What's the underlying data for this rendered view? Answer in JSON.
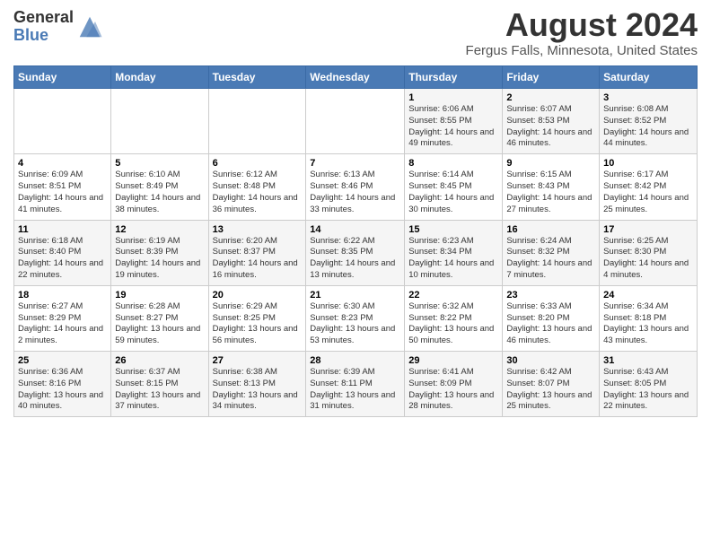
{
  "header": {
    "logo_general": "General",
    "logo_blue": "Blue",
    "month_title": "August 2024",
    "location": "Fergus Falls, Minnesota, United States"
  },
  "weekdays": [
    "Sunday",
    "Monday",
    "Tuesday",
    "Wednesday",
    "Thursday",
    "Friday",
    "Saturday"
  ],
  "weeks": [
    [
      {
        "day": "",
        "sunrise": "",
        "sunset": "",
        "daylight": ""
      },
      {
        "day": "",
        "sunrise": "",
        "sunset": "",
        "daylight": ""
      },
      {
        "day": "",
        "sunrise": "",
        "sunset": "",
        "daylight": ""
      },
      {
        "day": "",
        "sunrise": "",
        "sunset": "",
        "daylight": ""
      },
      {
        "day": "1",
        "sunrise": "Sunrise: 6:06 AM",
        "sunset": "Sunset: 8:55 PM",
        "daylight": "Daylight: 14 hours and 49 minutes."
      },
      {
        "day": "2",
        "sunrise": "Sunrise: 6:07 AM",
        "sunset": "Sunset: 8:53 PM",
        "daylight": "Daylight: 14 hours and 46 minutes."
      },
      {
        "day": "3",
        "sunrise": "Sunrise: 6:08 AM",
        "sunset": "Sunset: 8:52 PM",
        "daylight": "Daylight: 14 hours and 44 minutes."
      }
    ],
    [
      {
        "day": "4",
        "sunrise": "Sunrise: 6:09 AM",
        "sunset": "Sunset: 8:51 PM",
        "daylight": "Daylight: 14 hours and 41 minutes."
      },
      {
        "day": "5",
        "sunrise": "Sunrise: 6:10 AM",
        "sunset": "Sunset: 8:49 PM",
        "daylight": "Daylight: 14 hours and 38 minutes."
      },
      {
        "day": "6",
        "sunrise": "Sunrise: 6:12 AM",
        "sunset": "Sunset: 8:48 PM",
        "daylight": "Daylight: 14 hours and 36 minutes."
      },
      {
        "day": "7",
        "sunrise": "Sunrise: 6:13 AM",
        "sunset": "Sunset: 8:46 PM",
        "daylight": "Daylight: 14 hours and 33 minutes."
      },
      {
        "day": "8",
        "sunrise": "Sunrise: 6:14 AM",
        "sunset": "Sunset: 8:45 PM",
        "daylight": "Daylight: 14 hours and 30 minutes."
      },
      {
        "day": "9",
        "sunrise": "Sunrise: 6:15 AM",
        "sunset": "Sunset: 8:43 PM",
        "daylight": "Daylight: 14 hours and 27 minutes."
      },
      {
        "day": "10",
        "sunrise": "Sunrise: 6:17 AM",
        "sunset": "Sunset: 8:42 PM",
        "daylight": "Daylight: 14 hours and 25 minutes."
      }
    ],
    [
      {
        "day": "11",
        "sunrise": "Sunrise: 6:18 AM",
        "sunset": "Sunset: 8:40 PM",
        "daylight": "Daylight: 14 hours and 22 minutes."
      },
      {
        "day": "12",
        "sunrise": "Sunrise: 6:19 AM",
        "sunset": "Sunset: 8:39 PM",
        "daylight": "Daylight: 14 hours and 19 minutes."
      },
      {
        "day": "13",
        "sunrise": "Sunrise: 6:20 AM",
        "sunset": "Sunset: 8:37 PM",
        "daylight": "Daylight: 14 hours and 16 minutes."
      },
      {
        "day": "14",
        "sunrise": "Sunrise: 6:22 AM",
        "sunset": "Sunset: 8:35 PM",
        "daylight": "Daylight: 14 hours and 13 minutes."
      },
      {
        "day": "15",
        "sunrise": "Sunrise: 6:23 AM",
        "sunset": "Sunset: 8:34 PM",
        "daylight": "Daylight: 14 hours and 10 minutes."
      },
      {
        "day": "16",
        "sunrise": "Sunrise: 6:24 AM",
        "sunset": "Sunset: 8:32 PM",
        "daylight": "Daylight: 14 hours and 7 minutes."
      },
      {
        "day": "17",
        "sunrise": "Sunrise: 6:25 AM",
        "sunset": "Sunset: 8:30 PM",
        "daylight": "Daylight: 14 hours and 4 minutes."
      }
    ],
    [
      {
        "day": "18",
        "sunrise": "Sunrise: 6:27 AM",
        "sunset": "Sunset: 8:29 PM",
        "daylight": "Daylight: 14 hours and 2 minutes."
      },
      {
        "day": "19",
        "sunrise": "Sunrise: 6:28 AM",
        "sunset": "Sunset: 8:27 PM",
        "daylight": "Daylight: 13 hours and 59 minutes."
      },
      {
        "day": "20",
        "sunrise": "Sunrise: 6:29 AM",
        "sunset": "Sunset: 8:25 PM",
        "daylight": "Daylight: 13 hours and 56 minutes."
      },
      {
        "day": "21",
        "sunrise": "Sunrise: 6:30 AM",
        "sunset": "Sunset: 8:23 PM",
        "daylight": "Daylight: 13 hours and 53 minutes."
      },
      {
        "day": "22",
        "sunrise": "Sunrise: 6:32 AM",
        "sunset": "Sunset: 8:22 PM",
        "daylight": "Daylight: 13 hours and 50 minutes."
      },
      {
        "day": "23",
        "sunrise": "Sunrise: 6:33 AM",
        "sunset": "Sunset: 8:20 PM",
        "daylight": "Daylight: 13 hours and 46 minutes."
      },
      {
        "day": "24",
        "sunrise": "Sunrise: 6:34 AM",
        "sunset": "Sunset: 8:18 PM",
        "daylight": "Daylight: 13 hours and 43 minutes."
      }
    ],
    [
      {
        "day": "25",
        "sunrise": "Sunrise: 6:36 AM",
        "sunset": "Sunset: 8:16 PM",
        "daylight": "Daylight: 13 hours and 40 minutes."
      },
      {
        "day": "26",
        "sunrise": "Sunrise: 6:37 AM",
        "sunset": "Sunset: 8:15 PM",
        "daylight": "Daylight: 13 hours and 37 minutes."
      },
      {
        "day": "27",
        "sunrise": "Sunrise: 6:38 AM",
        "sunset": "Sunset: 8:13 PM",
        "daylight": "Daylight: 13 hours and 34 minutes."
      },
      {
        "day": "28",
        "sunrise": "Sunrise: 6:39 AM",
        "sunset": "Sunset: 8:11 PM",
        "daylight": "Daylight: 13 hours and 31 minutes."
      },
      {
        "day": "29",
        "sunrise": "Sunrise: 6:41 AM",
        "sunset": "Sunset: 8:09 PM",
        "daylight": "Daylight: 13 hours and 28 minutes."
      },
      {
        "day": "30",
        "sunrise": "Sunrise: 6:42 AM",
        "sunset": "Sunset: 8:07 PM",
        "daylight": "Daylight: 13 hours and 25 minutes."
      },
      {
        "day": "31",
        "sunrise": "Sunrise: 6:43 AM",
        "sunset": "Sunset: 8:05 PM",
        "daylight": "Daylight: 13 hours and 22 minutes."
      }
    ]
  ]
}
